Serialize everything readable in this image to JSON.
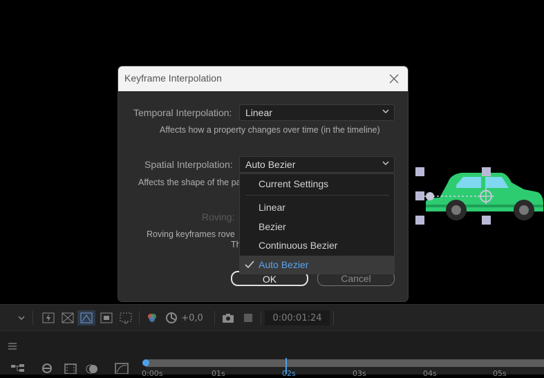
{
  "dialog": {
    "title": "Keyframe Interpolation",
    "temporal": {
      "label": "Temporal Interpolation:",
      "value": "Linear",
      "description": "Affects how a property changes over time (in the timeline)"
    },
    "spatial": {
      "label": "Spatial Interpolation:",
      "value": "Auto Bezier",
      "description_visible": "Affects the shape of the pa"
    },
    "roving": {
      "label": "Roving:",
      "description_line1_visible": "Roving keyframes rove",
      "description_line2_visible": "Th"
    },
    "ok_label": "OK",
    "cancel_label": "Cancel"
  },
  "dropdown": {
    "items": [
      {
        "label": "Current Settings",
        "selected": false
      },
      {
        "label": "Linear",
        "selected": false
      },
      {
        "label": "Bezier",
        "selected": false
      },
      {
        "label": "Continuous Bezier",
        "selected": false
      },
      {
        "label": "Auto Bezier",
        "selected": true
      }
    ]
  },
  "viewer_toolbar": {
    "exposure_value": "+0,0",
    "timecode": "0:00:01:24"
  },
  "timeline": {
    "ticks": [
      "0:00s",
      "01s",
      "02s",
      "03s",
      "04s",
      "05s"
    ]
  },
  "colors": {
    "accent": "#4d9fea",
    "car_body": "#2ecc71",
    "handle": "#b9b9d6"
  }
}
